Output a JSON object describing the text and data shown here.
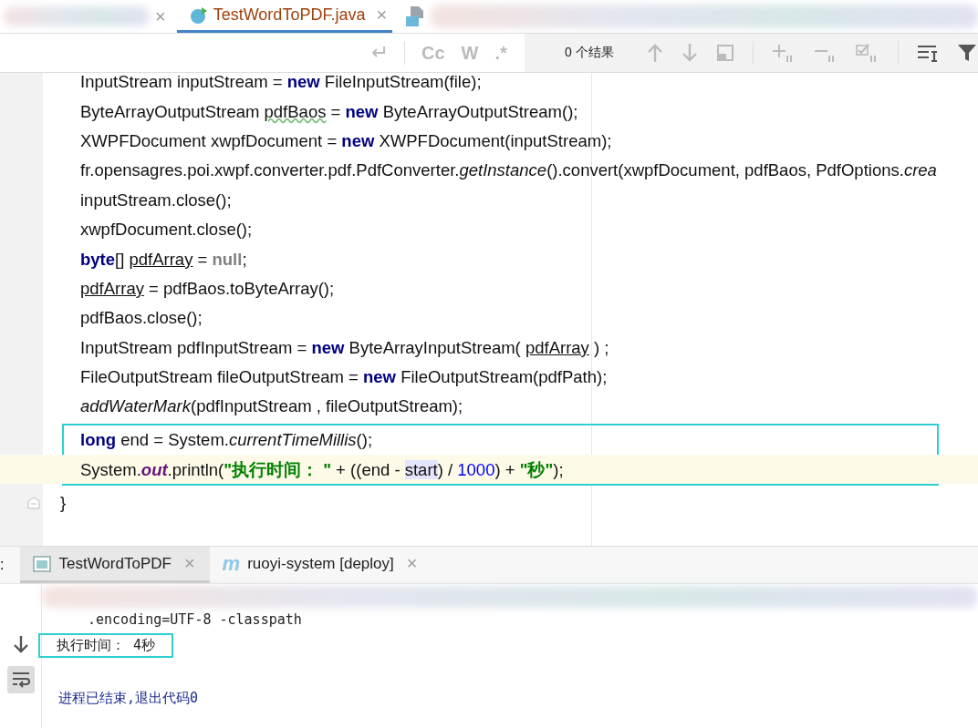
{
  "editor_tabs": [
    {
      "label": "TestWordToPDF.java",
      "selected": true
    }
  ],
  "find_bar": {
    "options": [
      "Cc",
      "W",
      ".*"
    ],
    "result_count": "0 个结果"
  },
  "code": {
    "blocks": [
      {
        "boxed": false,
        "lines": [
          {
            "kind": "stmt",
            "current": false,
            "tokens": [
              {
                "kind": "plain",
                "t": "InputStream inputStream = "
              },
              {
                "kind": "kw",
                "t": "new"
              },
              {
                "kind": "plain",
                "t": " FileInputStream(file);"
              }
            ]
          },
          {
            "kind": "stmt",
            "current": false,
            "tokens": [
              {
                "kind": "plain",
                "t": "ByteArrayOutputStream "
              },
              {
                "kind": "warn",
                "t": "pdfBaos"
              },
              {
                "kind": "plain",
                "t": " = "
              },
              {
                "kind": "kw",
                "t": "new"
              },
              {
                "kind": "plain",
                "t": " ByteArrayOutputStream();"
              }
            ]
          },
          {
            "kind": "stmt",
            "current": false,
            "tokens": [
              {
                "kind": "plain",
                "t": "XWPFDocument xwpfDocument = "
              },
              {
                "kind": "kw",
                "t": "new"
              },
              {
                "kind": "plain",
                "t": " XWPFDocument(inputStream);"
              }
            ]
          },
          {
            "kind": "stmt",
            "current": false,
            "tokens": [
              {
                "kind": "plain",
                "t": "fr.opensagres.poi.xwpf.converter.pdf.PdfConverter."
              },
              {
                "kind": "call",
                "t": "getInstance"
              },
              {
                "kind": "plain",
                "t": "().convert(xwpfDocument, pdfBaos, PdfOptions."
              },
              {
                "kind": "call",
                "t": "crea"
              }
            ]
          },
          {
            "kind": "stmt",
            "current": false,
            "tokens": [
              {
                "kind": "plain",
                "t": "inputStream.close();"
              }
            ]
          },
          {
            "kind": "stmt",
            "current": false,
            "tokens": [
              {
                "kind": "plain",
                "t": "xwpfDocument.close();"
              }
            ]
          },
          {
            "kind": "stmt",
            "current": false,
            "tokens": [
              {
                "kind": "kw",
                "t": "byte"
              },
              {
                "kind": "plain",
                "t": "[] "
              },
              {
                "kind": "var",
                "t": "pdfArray"
              },
              {
                "kind": "plain",
                "t": " = "
              },
              {
                "kind": "lit",
                "t": "null"
              },
              {
                "kind": "plain",
                "t": ";"
              }
            ]
          },
          {
            "kind": "stmt",
            "current": false,
            "tokens": [
              {
                "kind": "var",
                "t": "pdfArray"
              },
              {
                "kind": "plain",
                "t": " = pdfBaos.toByteArray();"
              }
            ]
          },
          {
            "kind": "stmt",
            "current": false,
            "tokens": [
              {
                "kind": "plain",
                "t": "pdfBaos.close();"
              }
            ]
          },
          {
            "kind": "stmt",
            "current": false,
            "tokens": [
              {
                "kind": "plain",
                "t": "InputStream pdfInputStream = "
              },
              {
                "kind": "kw",
                "t": "new"
              },
              {
                "kind": "plain",
                "t": " ByteArrayInputStream( "
              },
              {
                "kind": "var",
                "t": "pdfArray"
              },
              {
                "kind": "plain",
                "t": " ) ;"
              }
            ]
          },
          {
            "kind": "stmt",
            "current": false,
            "tokens": [
              {
                "kind": "plain",
                "t": "FileOutputStream fileOutputStream = "
              },
              {
                "kind": "kw",
                "t": "new"
              },
              {
                "kind": "plain",
                "t": " FileOutputStream(pdfPath);"
              }
            ]
          },
          {
            "kind": "stmt",
            "current": false,
            "tokens": [
              {
                "kind": "call",
                "t": "addWaterMark"
              },
              {
                "kind": "plain",
                "t": "(pdfInputStream , fileOutputStream);"
              }
            ]
          }
        ]
      },
      {
        "boxed": true,
        "lines": [
          {
            "kind": "stmt",
            "current": false,
            "tokens": [
              {
                "kind": "kw",
                "t": "long"
              },
              {
                "kind": "plain",
                "t": " end = System."
              },
              {
                "kind": "call",
                "t": "currentTimeMillis"
              },
              {
                "kind": "plain",
                "t": "();"
              }
            ]
          },
          {
            "kind": "stmt",
            "current": true,
            "tokens": [
              {
                "kind": "plain",
                "t": "System."
              },
              {
                "kind": "field",
                "t": "out"
              },
              {
                "kind": "plain",
                "t": ".println("
              },
              {
                "kind": "str",
                "t": "\"执行时间：  \""
              },
              {
                "kind": "plain",
                "t": " + ((end - "
              },
              {
                "kind": "hl",
                "t": "start"
              },
              {
                "kind": "plain",
                "t": ") / "
              },
              {
                "kind": "num",
                "t": "1000"
              },
              {
                "kind": "plain",
                "t": ") + "
              },
              {
                "kind": "str",
                "t": "\"秒\""
              },
              {
                "kind": "plain",
                "t": ");"
              }
            ]
          }
        ]
      },
      {
        "boxed": false,
        "lines": [
          {
            "kind": "brace",
            "current": false,
            "tokens": [
              {
                "kind": "plain",
                "t": "}"
              }
            ]
          }
        ]
      }
    ]
  },
  "tab_close_glyph": "×",
  "run_panel_label": ":",
  "run_tabs": [
    {
      "label": "TestWordToPDF",
      "kind": "app",
      "selected": true
    },
    {
      "label": "ruoyi-system [deploy]",
      "kind": "maven",
      "badge": "m",
      "selected": false
    }
  ],
  "console": {
    "lines": [
      {
        "kind": "cmd",
        "boxed": false,
        "text": ".encoding=UTF-8 -classpath"
      },
      {
        "kind": "out",
        "boxed": true,
        "text": "执行时间：  4秒"
      },
      {
        "kind": "exit",
        "boxed": false,
        "text": "进程已结束,退出代码0"
      }
    ]
  }
}
